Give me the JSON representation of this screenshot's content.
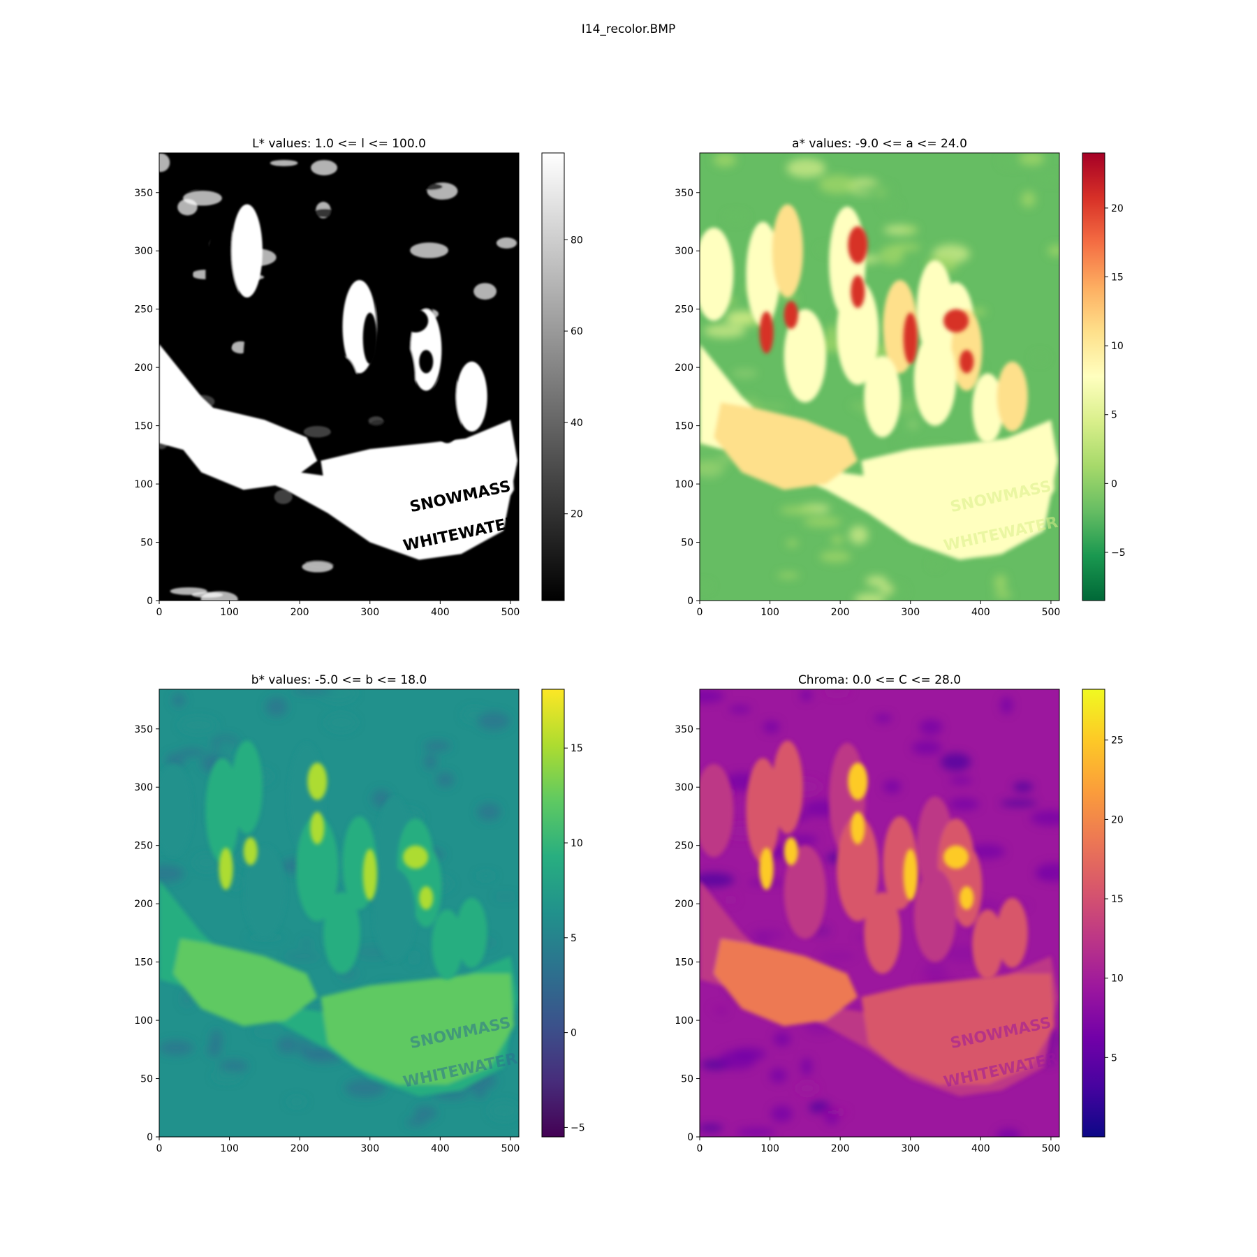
{
  "figure_title": "I14_recolor.BMP",
  "colors": {
    "gray_cmap": [
      "#000000",
      "#ffffff"
    ],
    "RdYlGn_r_cmap": [
      "#006837",
      "#1a9850",
      "#66bd63",
      "#a6d96a",
      "#d9ef8b",
      "#ffffbf",
      "#fee08b",
      "#fdae61",
      "#f46d43",
      "#d73027",
      "#a50026"
    ],
    "viridis_cmap": [
      "#440154",
      "#472d7b",
      "#3b528b",
      "#2c728e",
      "#21918c",
      "#28ae80",
      "#5ec962",
      "#addc30",
      "#fde725"
    ],
    "plasma_cmap": [
      "#0d0887",
      "#46039f",
      "#7201a8",
      "#9c179e",
      "#bd3786",
      "#d8576b",
      "#ed7953",
      "#fb9f3a",
      "#fdca26",
      "#f0f921"
    ]
  },
  "chart_data": [
    {
      "type": "heatmap",
      "id": "L",
      "title": "L* values: 1.0 <= l <= 100.0",
      "colormap": "gray",
      "value_range": [
        1.0,
        100.0
      ],
      "colorbar_range": [
        1.0,
        99.0
      ],
      "colorbar_ticks": [
        "20",
        "40",
        "60",
        "80"
      ],
      "colorbar_tick_values": [
        20,
        40,
        60,
        80
      ],
      "xlim": [
        0,
        512
      ],
      "ylim": [
        0,
        384
      ],
      "xticks": [
        "0",
        "100",
        "200",
        "300",
        "400",
        "500"
      ],
      "yticks": [
        "0",
        "50",
        "100",
        "150",
        "200",
        "250",
        "300",
        "350"
      ],
      "image_text": [
        "SNOWMASS",
        "WHITEWATER"
      ]
    },
    {
      "type": "heatmap",
      "id": "a",
      "title": "a* values: -9.0 <= a <= 24.0",
      "colormap": "RdYlGn_r",
      "value_range": [
        -9.0,
        24.0
      ],
      "colorbar_range": [
        -8.5,
        24.0
      ],
      "colorbar_ticks": [
        "−5",
        "0",
        "5",
        "10",
        "15",
        "20"
      ],
      "colorbar_tick_values": [
        -5,
        0,
        5,
        10,
        15,
        20
      ],
      "xlim": [
        0,
        512
      ],
      "ylim": [
        0,
        384
      ],
      "xticks": [
        "0",
        "100",
        "200",
        "300",
        "400",
        "500"
      ],
      "yticks": [
        "0",
        "50",
        "100",
        "150",
        "200",
        "250",
        "300",
        "350"
      ],
      "image_text": [
        "SNOWMASS",
        "WHITEWATER"
      ]
    },
    {
      "type": "heatmap",
      "id": "b",
      "title": "b* values: -5.0 <= b <= 18.0",
      "colormap": "viridis",
      "value_range": [
        -5.0,
        18.0
      ],
      "colorbar_range": [
        -5.5,
        18.1
      ],
      "colorbar_ticks": [
        "−5",
        "0",
        "5",
        "10",
        "15"
      ],
      "colorbar_tick_values": [
        -5,
        0,
        5,
        10,
        15
      ],
      "xlim": [
        0,
        512
      ],
      "ylim": [
        0,
        384
      ],
      "xticks": [
        "0",
        "100",
        "200",
        "300",
        "400",
        "500"
      ],
      "yticks": [
        "0",
        "50",
        "100",
        "150",
        "200",
        "250",
        "300",
        "350"
      ],
      "image_text": [
        "SNOWMASS",
        "WHITEWATER"
      ]
    },
    {
      "type": "heatmap",
      "id": "C",
      "title": "Chroma: 0.0 <= C <= 28.0",
      "colormap": "plasma",
      "value_range": [
        0.0,
        28.0
      ],
      "colorbar_range": [
        0.0,
        28.2
      ],
      "colorbar_ticks": [
        "5",
        "10",
        "15",
        "20",
        "25"
      ],
      "colorbar_tick_values": [
        5,
        10,
        15,
        20,
        25
      ],
      "xlim": [
        0,
        512
      ],
      "ylim": [
        0,
        384
      ],
      "xticks": [
        "0",
        "100",
        "200",
        "300",
        "400",
        "500"
      ],
      "yticks": [
        "0",
        "50",
        "100",
        "150",
        "200",
        "250",
        "300",
        "350"
      ],
      "image_text": [
        "SNOWMASS",
        "WHITEWATER"
      ]
    }
  ]
}
